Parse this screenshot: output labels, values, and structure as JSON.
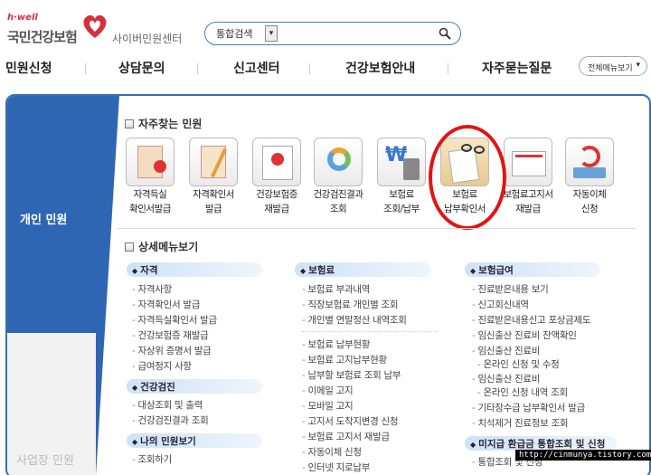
{
  "header": {
    "logo_small": "h·well",
    "logo_main": "국민건강보험",
    "logo_sub": "사이버민원센터"
  },
  "search": {
    "select_value": "통합검색",
    "placeholder": ""
  },
  "nav": {
    "items": [
      "민원신청",
      "상담문의",
      "신고센터",
      "건강보험안내",
      "자주묻는질문"
    ],
    "all_menu": "전체메뉴보기"
  },
  "sidebar": {
    "personal": "개인 민원",
    "business": "사업장 민원"
  },
  "faq": {
    "title": "자주찾는 민원",
    "tiles": [
      {
        "line1": "자격득실",
        "line2": "확인서발급",
        "icon": "form-stamp-icon"
      },
      {
        "line1": "자격확인서",
        "line2": "발급",
        "icon": "certificate-icon"
      },
      {
        "line1": "건강보험증",
        "line2": "재발급",
        "icon": "insurance-card-icon"
      },
      {
        "line1": "건강검진결과",
        "line2": "조회",
        "icon": "health-checkup-icon"
      },
      {
        "line1": "보험료",
        "line2": "조회/납부",
        "icon": "won-calculator-icon"
      },
      {
        "line1": "보험료",
        "line2": "납부확인서",
        "icon": "receipt-glasses-icon"
      },
      {
        "line1": "보험료고지서",
        "line2": "재발급",
        "icon": "bill-icon"
      },
      {
        "line1": "자동이체",
        "line2": "신청",
        "icon": "auto-transfer-icon"
      }
    ]
  },
  "detail": {
    "title": "상세메뉴보기",
    "col1": {
      "groups": [
        {
          "head": "자격",
          "items": [
            "자격사항",
            "자격확인서 발급",
            "자격득실확인서 발급",
            "건강보험증 재발급",
            "자상위 증명서 발급",
            "급여정지 사항"
          ]
        },
        {
          "head": "건강검진",
          "items": [
            "대상조회 및 출력",
            "건강검진결과 조회"
          ]
        },
        {
          "head": "나의 민원보기",
          "items": [
            "조회하기"
          ]
        }
      ]
    },
    "col2": {
      "groups": [
        {
          "head": "보험료",
          "items": [
            "보험료 부과내역",
            "직장보험료 개인별 조회",
            "개인별 연말정산 내역조회",
            "보험료 납부현황",
            "보험료 고지납부현황",
            "납부할 보험료 조회 납부",
            "이메일 고지",
            "모바일 고지",
            "고지서 도착지변경 신청",
            "보험료 고지서 재발급",
            "자동이체 신청",
            "인터넷 지로납부"
          ]
        }
      ]
    },
    "col3": {
      "groups": [
        {
          "head": "보험급여",
          "items": [
            "진료받은내용 보기",
            "신고회신내역",
            "진료받은내용신고 포상금제도",
            "임신출산 진료비 잔액확인",
            "임신출산 진료비",
            "온라인 신청 및 수정",
            "임신출산 진료비",
            "온라인 신청 내역 조회",
            "기타장수급 납부확인서 발급",
            "치석제거 진료정보 조회"
          ]
        },
        {
          "head": "미지급 환급금 통합조회 및 신청",
          "items": [
            "통합조회 및 신청"
          ]
        }
      ]
    }
  },
  "watermark": "http://cinmunya.tistory.com",
  "colors": {
    "accent": "#2f66b3",
    "highlight_circle": "#e01616",
    "logo_red": "#d4323b"
  }
}
